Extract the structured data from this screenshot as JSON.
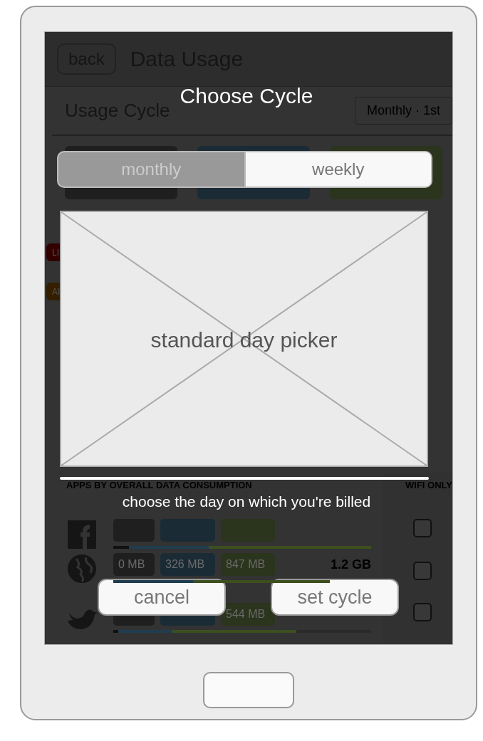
{
  "screen": {
    "back_button": "back",
    "title": "Data Usage",
    "usage_cycle": {
      "label": "Usage Cycle",
      "value": "Monthly · 1st"
    },
    "summary_chips": [
      {
        "kind": "dark"
      },
      {
        "kind": "blue"
      },
      {
        "kind": "green"
      }
    ],
    "badges": [
      {
        "text": "LI",
        "color": "#330000"
      },
      {
        "text": "AI",
        "color": "#331f00"
      }
    ],
    "apps": {
      "heading": "APPS BY OVERALL DATA CONSUMPTION",
      "wifi_heading": "WIFI ONLY",
      "rows": [
        {
          "kind": "f-logo",
          "chips": [
            {
              "kind": "dark"
            },
            {
              "kind": "blue"
            },
            {
              "kind": "green"
            }
          ],
          "segments": [
            {
              "color": "#111111",
              "level": 0.06
            },
            {
              "color": "#1f3d4f",
              "level": 0.37
            },
            {
              "color": "#3d4f1f",
              "level": 1.0
            }
          ],
          "wifi_only": false
        },
        {
          "kind": "globe",
          "chips": [
            {
              "kind": "dark",
              "text": "0 MB"
            },
            {
              "kind": "blue",
              "text": "326 MB"
            },
            {
              "kind": "green",
              "text": "847 MB"
            }
          ],
          "total": "1.2 GB",
          "segments": [
            {
              "color": "#1f3d4f",
              "level": 0.31
            },
            {
              "color": "#3d4f1f",
              "level": 0.84
            }
          ],
          "wifi_only": false
        },
        {
          "kind": "bird",
          "chips": [
            {
              "kind": "dark"
            },
            {
              "kind": "blue"
            },
            {
              "kind": "green",
              "text": "544 MB"
            }
          ],
          "segments": [
            {
              "color": "#111111",
              "level": 0.02
            },
            {
              "color": "#1f3d4f",
              "level": 0.23
            },
            {
              "color": "#3d4f1f",
              "level": 0.71
            }
          ],
          "wifi_only": false
        }
      ]
    }
  },
  "dialog": {
    "title": "Choose Cycle",
    "segments": [
      {
        "label": "monthly",
        "selected": true
      },
      {
        "label": "weekly",
        "selected": false
      }
    ],
    "picker": {
      "label": "standard day picker"
    },
    "caption": "choose the day on which you're billed",
    "buttons": [
      "cancel",
      "set cycle"
    ]
  }
}
